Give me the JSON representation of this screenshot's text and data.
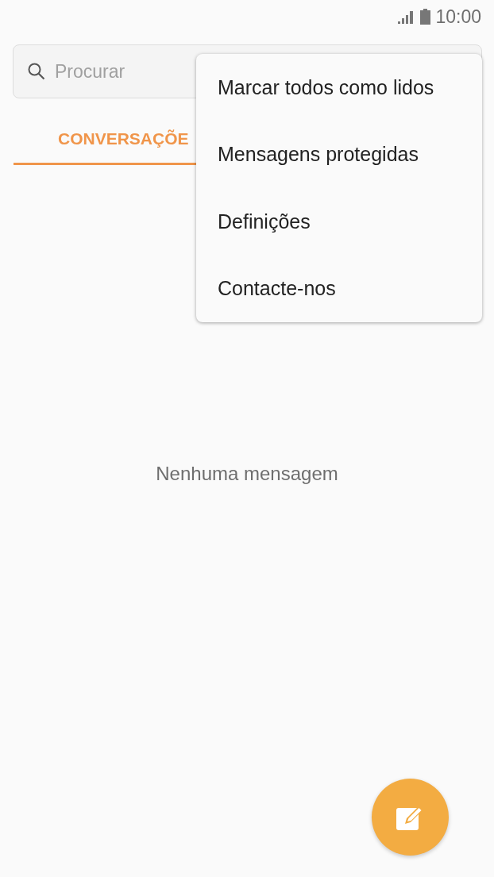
{
  "status_bar": {
    "time": "10:00"
  },
  "search": {
    "placeholder": "Procurar"
  },
  "tabs": [
    {
      "label": "CONVERSAÇÕE",
      "selected": true
    }
  ],
  "menu": {
    "items": [
      {
        "label": "Marcar todos como lidos"
      },
      {
        "label": "Mensagens protegidas"
      },
      {
        "label": "Definições"
      },
      {
        "label": "Contacte-nos"
      }
    ]
  },
  "empty_message": "Nenhuma mensagem"
}
